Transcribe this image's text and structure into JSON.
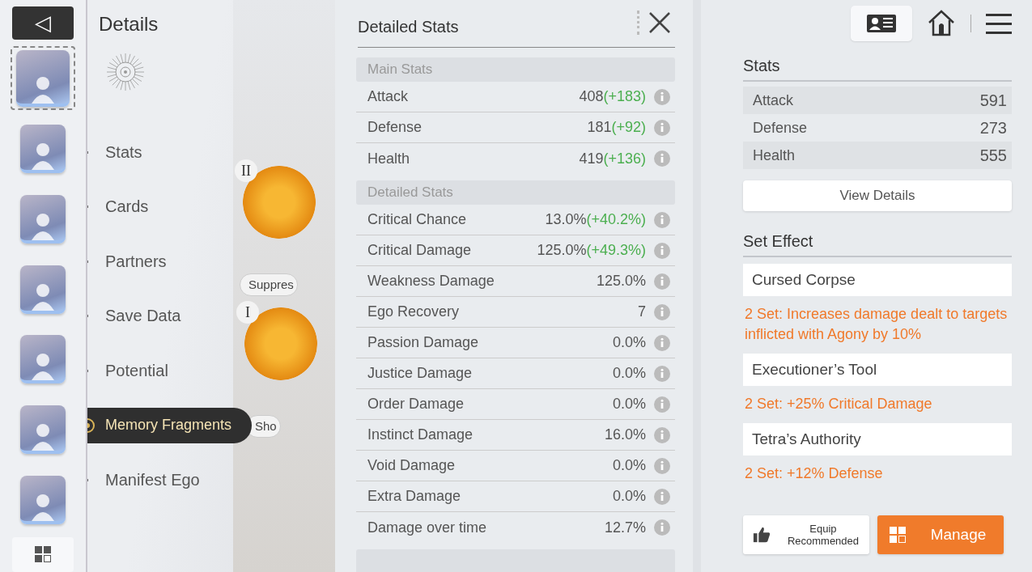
{
  "back_button": {
    "label": "◁"
  },
  "characters": [
    {
      "selected": true
    },
    {
      "selected": false
    },
    {
      "selected": false
    },
    {
      "selected": false
    },
    {
      "selected": false
    },
    {
      "selected": false
    },
    {
      "selected": false
    }
  ],
  "title": "Details",
  "nav": [
    {
      "label": "Stats",
      "selected": false
    },
    {
      "label": "Cards",
      "selected": false
    },
    {
      "label": "Partners",
      "selected": false
    },
    {
      "label": "Save Data",
      "selected": false
    },
    {
      "label": "Potential",
      "selected": false
    },
    {
      "label": "Memory Fragments",
      "selected": true
    },
    {
      "label": "Manifest Ego",
      "selected": false
    }
  ],
  "artwork": {
    "slots": [
      {
        "numeral": "II",
        "tag": "Suppres"
      },
      {
        "numeral": "I",
        "tag": "Sho"
      }
    ]
  },
  "detail_panel": {
    "title": "Detailed Stats",
    "groups": [
      {
        "header": "Main Stats",
        "rows": [
          {
            "name": "Attack",
            "value": "408",
            "bonus": "(+183)"
          },
          {
            "name": "Defense",
            "value": "181",
            "bonus": "(+92)"
          },
          {
            "name": "Health",
            "value": "419",
            "bonus": "(+136)"
          }
        ]
      },
      {
        "header": "Detailed Stats",
        "rows": [
          {
            "name": "Critical Chance",
            "value": "13.0%",
            "bonus": "(+40.2%)"
          },
          {
            "name": "Critical Damage",
            "value": "125.0%",
            "bonus": "(+49.3%)"
          },
          {
            "name": "Weakness Damage",
            "value": "125.0%"
          },
          {
            "name": "Ego Recovery",
            "value": "7"
          },
          {
            "name": "Passion Damage",
            "value": "0.0%"
          },
          {
            "name": "Justice Damage",
            "value": "0.0%"
          },
          {
            "name": "Order Damage",
            "value": "0.0%"
          },
          {
            "name": "Instinct Damage",
            "value": "16.0%"
          },
          {
            "name": "Void Damage",
            "value": "0.0%"
          },
          {
            "name": "Extra Damage",
            "value": "0.0%"
          },
          {
            "name": "Damage over time",
            "value": "12.7%"
          }
        ]
      }
    ]
  },
  "top_bar": {
    "profile_selected": true
  },
  "stats": {
    "title": "Stats",
    "rows": [
      {
        "name": "Attack",
        "value": "591"
      },
      {
        "name": "Defense",
        "value": "273"
      },
      {
        "name": "Health",
        "value": "555"
      }
    ],
    "button": "View Details"
  },
  "set_effect": {
    "title": "Set Effect",
    "sets": [
      {
        "name": "Cursed Corpse",
        "effect": "2 Set: Increases damage dealt to targets inflicted with Agony by 10%"
      },
      {
        "name": "Executioner’s Tool",
        "effect": "2 Set: +25% Critical Damage"
      },
      {
        "name": "Tetra’s Authority",
        "effect": "2 Set: +12% Defense"
      }
    ]
  },
  "buttons": [
    {
      "kind": "secondary",
      "label": "Equip Recommended"
    },
    {
      "kind": "primary",
      "label": "Manage"
    }
  ]
}
